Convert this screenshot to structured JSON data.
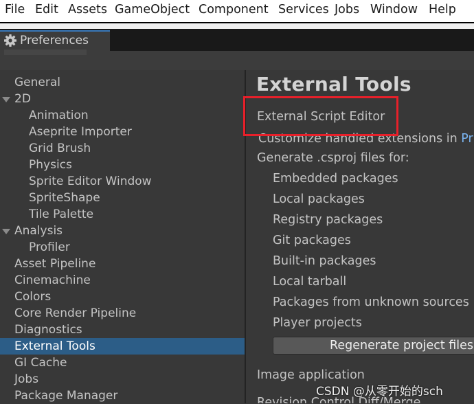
{
  "menubar": {
    "items": [
      "File",
      "Edit",
      "Assets",
      "GameObject",
      "Component",
      "Services",
      "Jobs",
      "Window",
      "Help"
    ]
  },
  "window": {
    "tab_title": "Preferences",
    "tab_icon": "gear-icon"
  },
  "sidebar": {
    "items": [
      {
        "label": "General",
        "level": 0
      },
      {
        "label": "2D",
        "level": 0,
        "expanded": true
      },
      {
        "label": "Animation",
        "level": 1
      },
      {
        "label": "Aseprite Importer",
        "level": 1
      },
      {
        "label": "Grid Brush",
        "level": 1
      },
      {
        "label": "Physics",
        "level": 1
      },
      {
        "label": "Sprite Editor Window",
        "level": 1
      },
      {
        "label": "SpriteShape",
        "level": 1
      },
      {
        "label": "Tile Palette",
        "level": 1
      },
      {
        "label": "Analysis",
        "level": 0,
        "expanded": true
      },
      {
        "label": "Profiler",
        "level": 1
      },
      {
        "label": "Asset Pipeline",
        "level": 0
      },
      {
        "label": "Cinemachine",
        "level": 0
      },
      {
        "label": "Colors",
        "level": 0
      },
      {
        "label": "Core Render Pipeline",
        "level": 0
      },
      {
        "label": "Diagnostics",
        "level": 0
      },
      {
        "label": "External Tools",
        "level": 0,
        "selected": true
      },
      {
        "label": "GI Cache",
        "level": 0
      },
      {
        "label": "Jobs",
        "level": 0
      },
      {
        "label": "Package Manager",
        "level": 0
      }
    ]
  },
  "content": {
    "title": "External Tools",
    "script_editor_label": "External Script Editor",
    "customize_text": "Customize handled extensions in",
    "customize_link": "Pr",
    "generate_label": "Generate .csproj files for:",
    "options": [
      "Embedded packages",
      "Local packages",
      "Registry packages",
      "Git packages",
      "Built-in packages",
      "Local tarball",
      "Packages from unknown sources",
      "Player projects"
    ],
    "regenerate_button": "Regenerate project files",
    "image_application_label": "Image application",
    "revision_label": "Revision Control Diff/Merge"
  },
  "watermark": "CSDN @从零开始的sch",
  "colors": {
    "selection": "#2c5d87",
    "highlight_box": "#e8202a",
    "panel_bg": "#383838",
    "link": "#7ab4f0"
  }
}
